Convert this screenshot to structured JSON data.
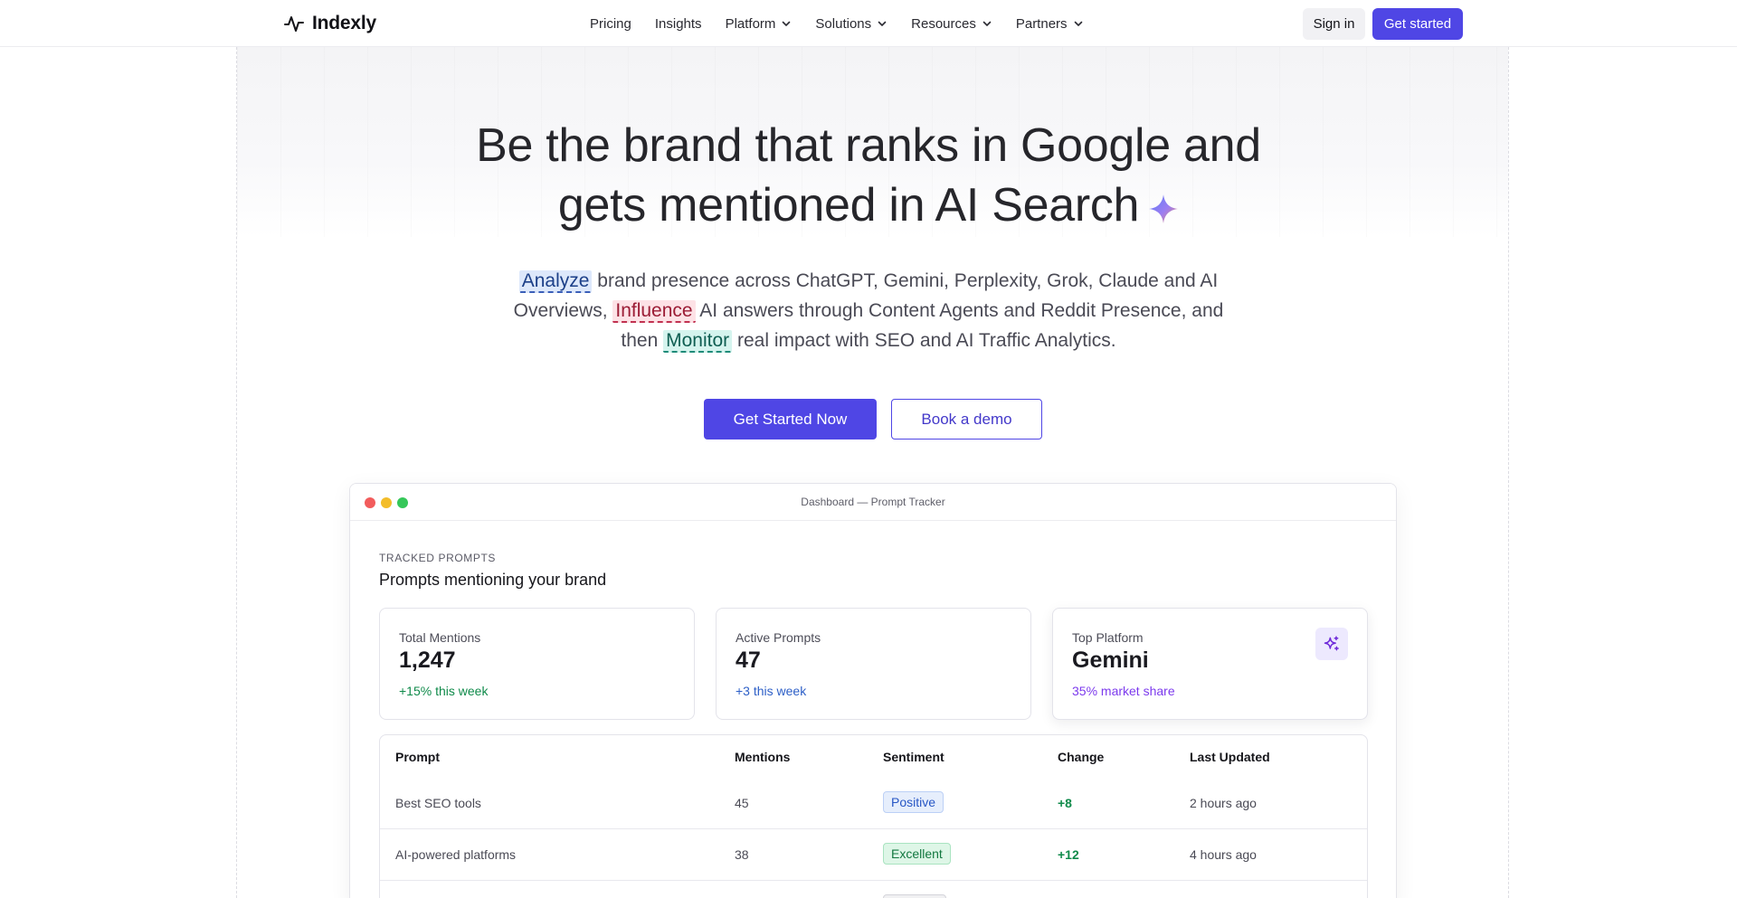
{
  "brand": {
    "name": "Indexly",
    "logo_icon": "activity-pulse-icon"
  },
  "nav": {
    "items": [
      {
        "label": "Pricing",
        "dropdown": false
      },
      {
        "label": "Insights",
        "dropdown": false
      },
      {
        "label": "Platform",
        "dropdown": true
      },
      {
        "label": "Solutions",
        "dropdown": true
      },
      {
        "label": "Resources",
        "dropdown": true
      },
      {
        "label": "Partners",
        "dropdown": true
      }
    ],
    "sign_in": "Sign in",
    "get_started": "Get started"
  },
  "hero": {
    "title_line1": "Be the brand that ranks in Google and",
    "title_line2": "gets mentioned in AI Search",
    "subtitle": {
      "word_analyze": "Analyze",
      "part1": " brand presence across ChatGPT, Gemini, Perplexity, Grok, Claude and AI Overviews, ",
      "word_influence": "Influence",
      "part2": " AI answers through Content Agents and Reddit Presence, and then ",
      "word_monitor": "Monitor",
      "part3": " real impact with SEO and AI Traffic Analytics."
    },
    "cta_primary": "Get Started Now",
    "cta_secondary": "Book a demo"
  },
  "dashboard": {
    "window_title": "Dashboard — Prompt Tracker",
    "eyebrow": "TRACKED PROMPTS",
    "title": "Prompts mentioning your brand",
    "stats": [
      {
        "label": "Total Mentions",
        "value": "1,247",
        "delta": "+15% this week"
      },
      {
        "label": "Active Prompts",
        "value": "47",
        "delta": "+3 this week"
      },
      {
        "label": "Top Platform",
        "value": "Gemini",
        "delta": "35% market share",
        "icon": "sparkles-icon"
      }
    ],
    "table": {
      "headers": [
        "Prompt",
        "Mentions",
        "Sentiment",
        "Change",
        "Last Updated"
      ],
      "rows": [
        {
          "prompt": "Best SEO tools",
          "mentions": "45",
          "sentiment": "Positive",
          "change": "+8",
          "updated": "2 hours ago"
        },
        {
          "prompt": "AI-powered platforms",
          "mentions": "38",
          "sentiment": "Excellent",
          "change": "+12",
          "updated": "4 hours ago"
        }
      ]
    }
  },
  "colors": {
    "accent": "#4f46e5",
    "positive": "#0f8a4a",
    "highlight_blue": "#dde8fb",
    "highlight_red": "#fde2e6",
    "highlight_teal": "#d5f4ee"
  }
}
